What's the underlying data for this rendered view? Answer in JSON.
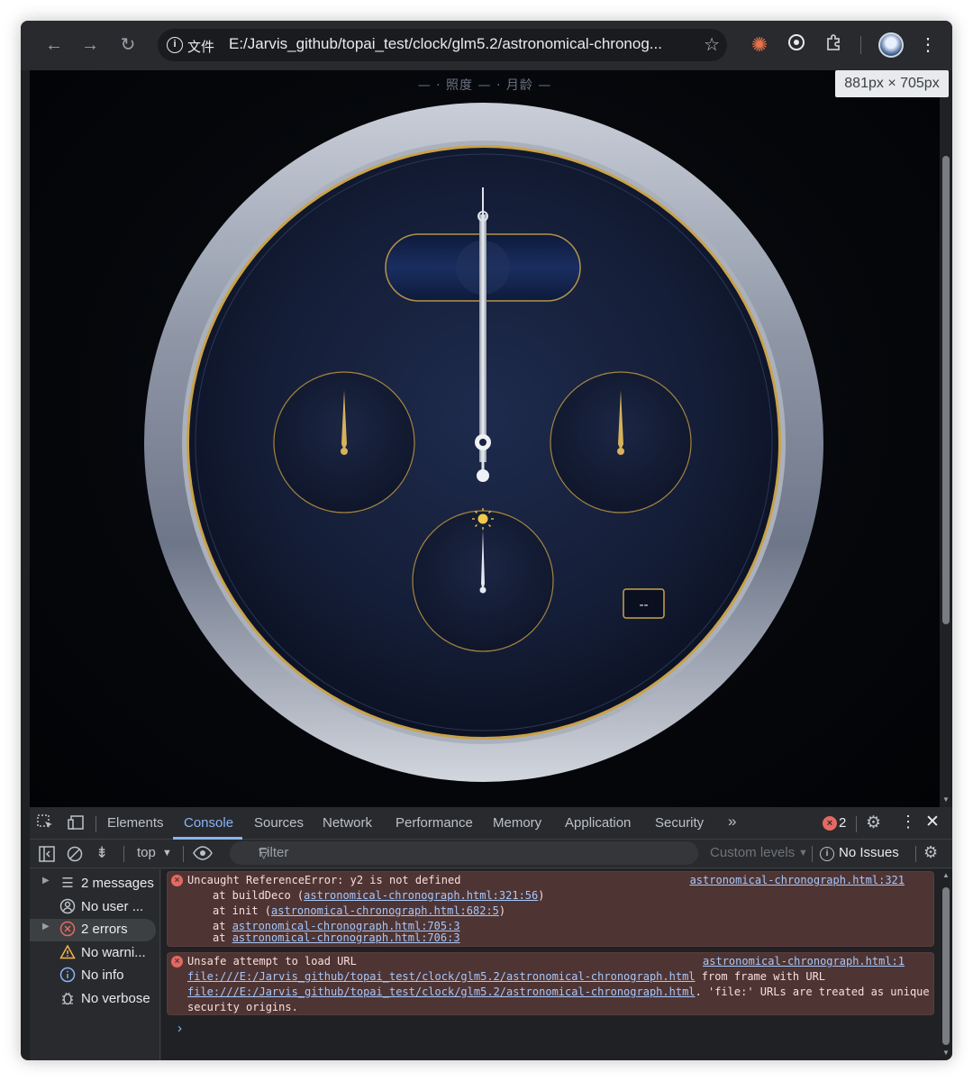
{
  "browser": {
    "address_prefix": "文件",
    "url": "E:/Jarvis_github/topai_test/clock/glm5.2/astronomical-chronog...",
    "dimension_badge": "881px × 705px"
  },
  "page": {
    "phase_label": "— · 照度 — · 月龄 —",
    "date_window": "--"
  },
  "devtools": {
    "tabs": [
      "Elements",
      "Console",
      "Sources",
      "Network",
      "Performance",
      "Memory",
      "Application",
      "Security"
    ],
    "active_tab": "Console",
    "more_tabs": "»",
    "error_count": "2",
    "context": "top",
    "filter_placeholder": "Filter",
    "levels": "Custom levels",
    "issues": "No Issues",
    "sidebar": [
      {
        "label": "2 messages",
        "icon": "list-icon",
        "expandable": true
      },
      {
        "label": "No user ...",
        "icon": "user-icon",
        "expandable": false
      },
      {
        "label": "2 errors",
        "icon": "error-icon",
        "expandable": true
      },
      {
        "label": "No warni...",
        "icon": "warning-icon",
        "expandable": false
      },
      {
        "label": "No info",
        "icon": "info-icon",
        "expandable": false
      },
      {
        "label": "No verbose",
        "icon": "bug-icon",
        "expandable": false
      }
    ],
    "errors": [
      {
        "message": "Uncaught ReferenceError: y2 is not defined",
        "source": "astronomical-chronograph.html:321",
        "stack": [
          {
            "prefix": "at buildDeco (",
            "link": "astronomical-chronograph.html:321:56",
            "suffix": ")"
          },
          {
            "prefix": "at init (",
            "link": "astronomical-chronograph.html:682:5",
            "suffix": ")"
          },
          {
            "prefix": "at ",
            "link": "astronomical-chronograph.html:705:3",
            "suffix": ""
          },
          {
            "prefix": "at ",
            "link": "astronomical-chronograph.html:706:3",
            "suffix": ""
          }
        ]
      },
      {
        "message": "Unsafe attempt to load URL",
        "source": "astronomical-chronograph.html:1",
        "line2_link": "file:///E:/Jarvis_github/topai_test/clock/glm5.2/astronomical-chronograph.html",
        "line2_text": " from frame with URL",
        "line3_link": "file:///E:/Jarvis_github/topai_test/clock/glm5.2/astronomical-chronograph.html",
        "line3_text": ". 'file:' URLs are treated as unique",
        "line4_text": "security origins."
      }
    ],
    "prompt": "›"
  },
  "colors": {
    "accent": "#8ab4f8",
    "error_bg": "#4e3534",
    "gold": "#c9a24a",
    "dial": "#16203a"
  }
}
